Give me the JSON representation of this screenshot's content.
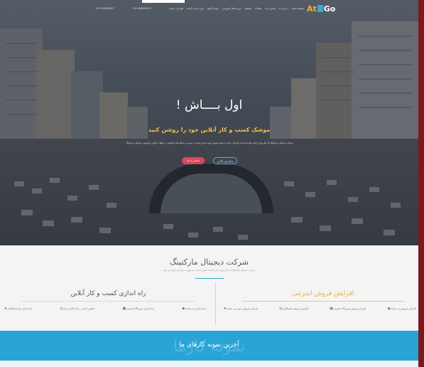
{
  "header": {
    "logo_prefix": "At",
    "logo_suffix": "Go",
    "menu": [
      "صفحه اصلی",
      "درباره ما",
      "تماس با ما",
      "مقالات",
      "تبلیغات",
      "دوره های آموزشی",
      "نمونه کارها",
      "خرید سایت آماده",
      "طراحی سایت"
    ],
    "phones": [
      "021-91008907",
      "021-66491221"
    ]
  },
  "hero": {
    "title": "اول بــــاش !",
    "subtitle": "موشک کسب و کار آنلاین خود را روشن کنید",
    "description": "شرکت دیجیتال مارکتینگ آت گو تهران ارائه دهنده خدمات طراحی سایت | تولید محتوا | بهینه سازی سایت | مدیریت شبکه های اجتماعی | تبلیغات آنلاین و آموزش دیجیتال مارکتینگ",
    "contact_button": "تماس با ما",
    "order_button": "سفارش آنلاین"
  },
  "company": {
    "title": "شرکت دیجیتال مارکتینگ",
    "subtitle": "شرکت دیجیتال مارکتینگ آت گو تهران تمام خدمات آنلاین شما را به صورت حرفه ای ارائه می دهد",
    "right_column": {
      "title": "افزایش فروش اینترنتی",
      "items": [
        {
          "label": "افزایش فروش وب سایت",
          "icon": "globe-icon"
        },
        {
          "label": "افزایش فروش فروشگاه اینترنتی",
          "icon": "cart-icon"
        },
        {
          "label": "افزایش فروش اینستاگرام",
          "icon": "instagram-icon"
        },
        {
          "label": "افزایش فروش بدون وب سایت",
          "icon": "rocket-icon"
        }
      ]
    },
    "left_column": {
      "title": "راه اندازی کسب و کار آنلاین",
      "items": [
        {
          "label": "راه اندازی وب سایت",
          "icon": "globe-icon"
        },
        {
          "label": "راه اندازی فروشگاه اینترنتی",
          "icon": "cart-icon"
        },
        {
          "label": "مشاوره کسب و کار آنلاین ایران",
          "icon": "support-icon"
        },
        {
          "label": "راه اندازی پیج اینستاگرام",
          "icon": "rocket-icon"
        }
      ]
    }
  },
  "latest_works": {
    "ghost_text": "نمونه کارها",
    "title": "آخرین نمونه کارهای ما"
  },
  "colors": {
    "accent_blue": "#2aa4d6",
    "accent_yellow": "#e0b23c",
    "contact_red": "#d9475a",
    "frame_red": "#7a1a1e"
  }
}
